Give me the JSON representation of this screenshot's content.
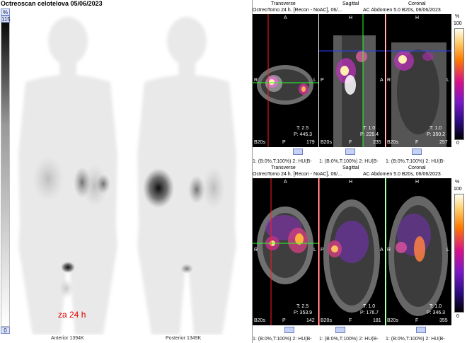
{
  "window": {
    "title": "Octreoscan celotelova 05/06/2023"
  },
  "planar": {
    "scale_unit": "%",
    "scale_max": "115",
    "scale_min": "0",
    "label_time": "za 24 h",
    "anterior_caption": "Anterior 1394K",
    "posterior_caption": "Posterior 1349K"
  },
  "spect_top": {
    "header_left": "OctreoTomo 24 h. [Recon - NoAC], 06/...",
    "header_right": "AC  Abdomen  5.0  B20s, 06/06/2023",
    "views": [
      {
        "label": "Transverse",
        "top": "A",
        "left": "R",
        "right": "L",
        "t": "T: 2.5",
        "p": "P: 445.3",
        "slice": "179",
        "series": "B20s",
        "bottom_label": "P"
      },
      {
        "label": "Sagittal",
        "top": "H",
        "left": "P",
        "right": "A",
        "t": "T: 1.0",
        "p": "P: 229.4",
        "slice": "235",
        "series": "B20s",
        "bottom_label": "F"
      },
      {
        "label": "Coronal",
        "top": "H",
        "left": "R",
        "right": "L",
        "t": "T: 1.0",
        "p": "P: 350.2",
        "slice": "257",
        "series": "B20s",
        "bottom_label": "F"
      }
    ],
    "window_labels": [
      "1: (B:0%,T:100%) 2: HU(B-",
      "1: (B:0%,T:100%) 2: HU(B-",
      "1: (B:0%,T:100%) 2: HU(B-"
    ],
    "colorbar": {
      "unit": "%",
      "max": "100",
      "min": "0"
    }
  },
  "spect_bottom": {
    "header_left": "OctreoTomo 24 h. [Recon - NoAC], 06/...",
    "header_right": "AC  Abdomen  5.0  B20s, 06/06/2023",
    "views": [
      {
        "label": "Transverse",
        "top": "A",
        "left": "R",
        "right": "L",
        "t": "T: 2.5",
        "p": "P: 353.9",
        "slice": "142",
        "series": "B20s",
        "bottom_label": "P"
      },
      {
        "label": "Sagittal",
        "top": "H",
        "left": "P",
        "right": "A",
        "t": "T: 1.0",
        "p": "P: 176.7",
        "slice": "181",
        "series": "B20s",
        "bottom_label": "F"
      },
      {
        "label": "Coronal",
        "top": "H",
        "left": "R",
        "right": "L",
        "t": "T: 1.0",
        "p": "P: 346.3",
        "slice": "355",
        "series": "B20s",
        "bottom_label": "F"
      }
    ],
    "window_labels": [
      "1: (B:0%,T:100%) 2: HU(B-",
      "1: (B:0%,T:100%) 2: HU(B-",
      "1: (B:0%,T:100%) 2: HU(B-"
    ],
    "colorbar": {
      "unit": "%",
      "max": "100",
      "min": "0"
    }
  },
  "colors": {
    "crosshair_red": "#ff2020",
    "crosshair_green": "#2aff2a",
    "crosshair_blue": "#2a3cff",
    "slider": "#c6d2f5",
    "time_label": "#e00000"
  }
}
